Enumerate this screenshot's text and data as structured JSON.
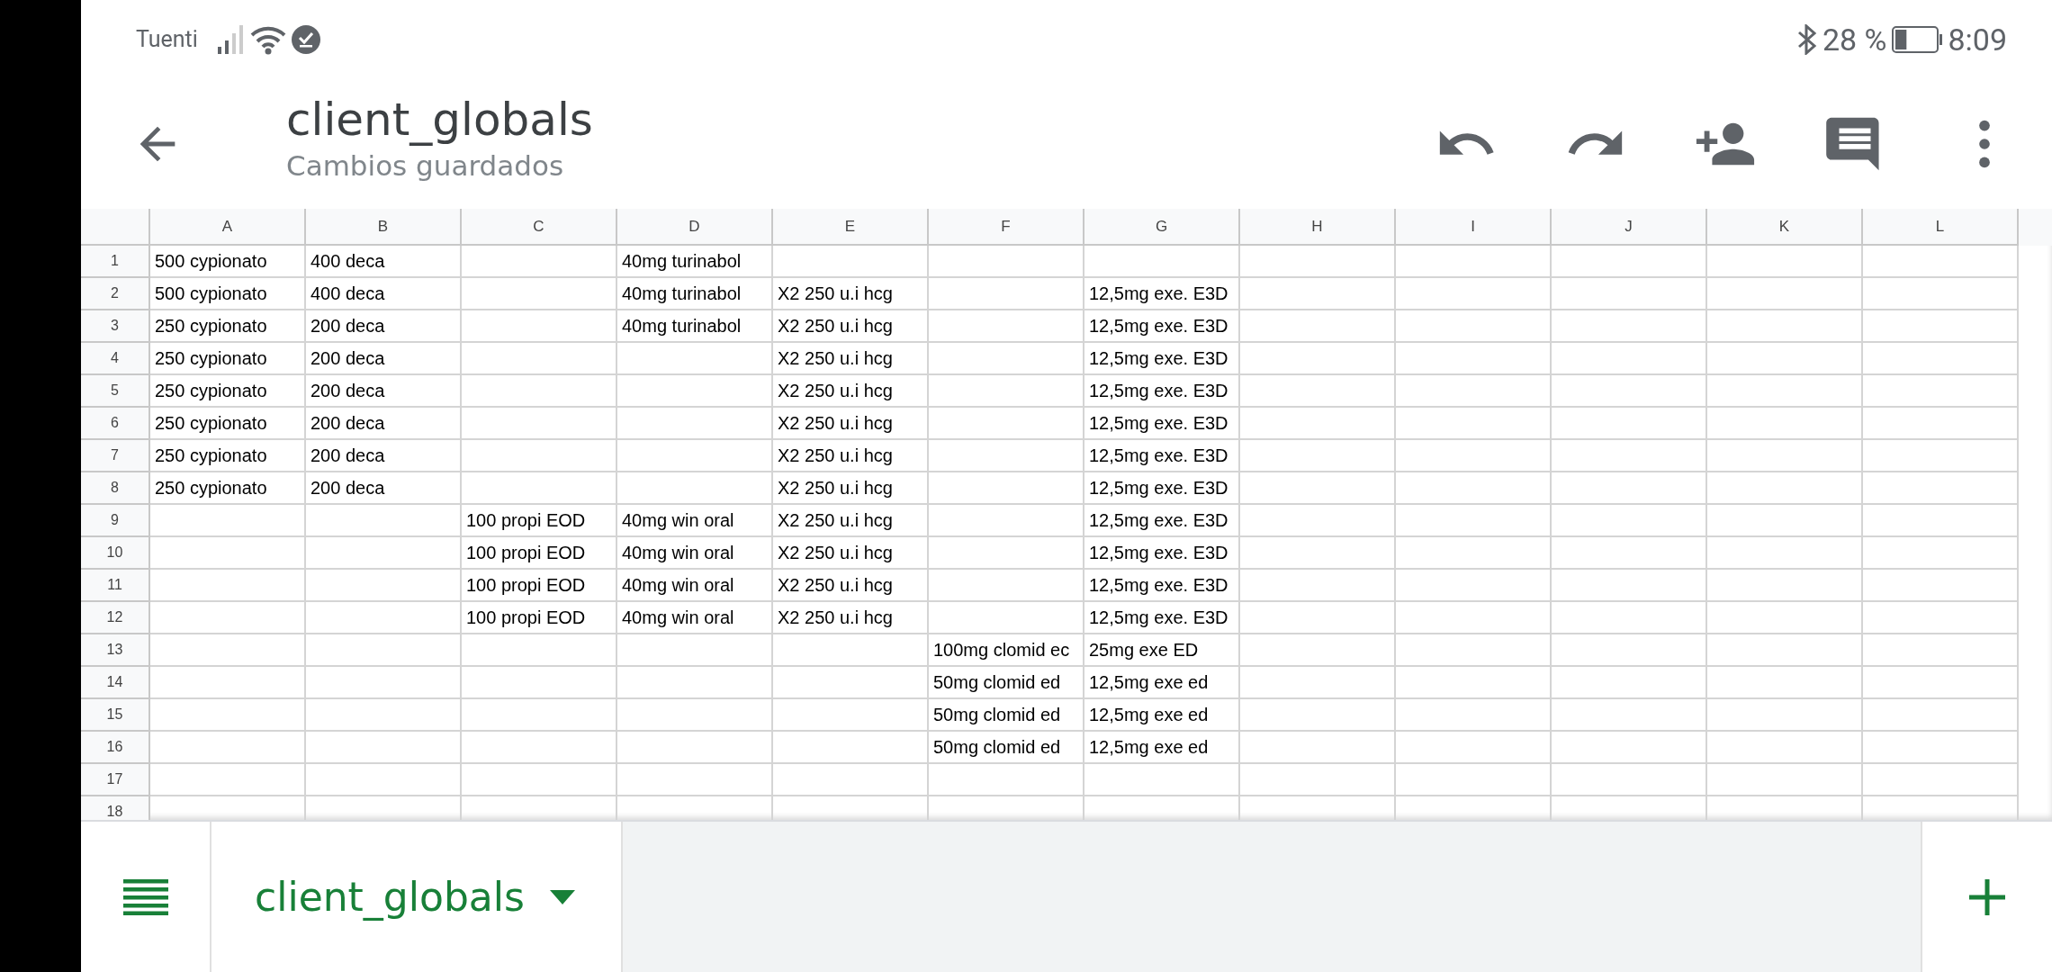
{
  "status_bar": {
    "carrier": "Tuenti",
    "battery_percent": "28 %",
    "time": "8:09"
  },
  "header": {
    "title": "client_globals",
    "subtitle": "Cambios guardados"
  },
  "columns": [
    "A",
    "B",
    "C",
    "D",
    "E",
    "F",
    "G",
    "H",
    "I",
    "J",
    "K",
    "L"
  ],
  "rows": [
    {
      "number": "1",
      "cells": [
        "500 cypionato",
        "400 deca",
        null,
        "40mg turinabol",
        null,
        null,
        null
      ]
    },
    {
      "number": "2",
      "cells": [
        "500 cypionato",
        "400 deca",
        null,
        "40mg turinabol",
        "X2  250 u.i hcg",
        null,
        "12,5mg exe. E3D"
      ]
    },
    {
      "number": "3",
      "cells": [
        "250 cypionato",
        "200 deca",
        null,
        "40mg turinabol",
        "X2  250 u.i hcg",
        null,
        "12,5mg exe. E3D"
      ]
    },
    {
      "number": "4",
      "cells": [
        "250 cypionato",
        "200 deca",
        null,
        null,
        "X2  250 u.i hcg",
        null,
        "12,5mg exe. E3D"
      ]
    },
    {
      "number": "5",
      "cells": [
        "250 cypionato",
        "200 deca",
        null,
        null,
        "X2  250 u.i hcg",
        null,
        "12,5mg exe. E3D"
      ]
    },
    {
      "number": "6",
      "cells": [
        "250 cypionato",
        "200 deca",
        null,
        null,
        "X2  250 u.i hcg",
        null,
        "12,5mg exe. E3D"
      ]
    },
    {
      "number": "7",
      "cells": [
        "250 cypionato",
        "200 deca",
        null,
        null,
        "X2  250 u.i hcg",
        null,
        "12,5mg exe. E3D"
      ]
    },
    {
      "number": "8",
      "cells": [
        "250 cypionato",
        "200 deca",
        null,
        null,
        "X2  250 u.i hcg",
        null,
        "12,5mg exe. E3D"
      ]
    },
    {
      "number": "9",
      "cells": [
        null,
        null,
        "100 propi EOD",
        "40mg win oral",
        "X2  250 u.i hcg",
        null,
        "12,5mg exe. E3D"
      ]
    },
    {
      "number": "10",
      "cells": [
        null,
        null,
        "100 propi EOD",
        "40mg win oral",
        "X2  250 u.i hcg",
        null,
        "12,5mg exe. E3D"
      ]
    },
    {
      "number": "11",
      "cells": [
        null,
        null,
        "100 propi EOD",
        "40mg win oral",
        "X2  250 u.i hcg",
        null,
        "12,5mg exe. E3D"
      ]
    },
    {
      "number": "12",
      "cells": [
        null,
        null,
        "100 propi EOD",
        "40mg win oral",
        "X2  250 u.i hcg",
        null,
        "12,5mg exe. E3D"
      ]
    },
    {
      "number": "13",
      "cells": [
        null,
        null,
        null,
        null,
        null,
        "100mg clomid ec",
        "25mg exe ED"
      ]
    },
    {
      "number": "14",
      "cells": [
        null,
        null,
        null,
        null,
        null,
        "50mg clomid ed",
        "12,5mg exe ed"
      ]
    },
    {
      "number": "15",
      "cells": [
        null,
        null,
        null,
        null,
        null,
        "50mg clomid ed",
        "12,5mg exe ed"
      ]
    },
    {
      "number": "16",
      "cells": [
        null,
        null,
        null,
        null,
        null,
        "50mg clomid ed",
        "12,5mg exe ed"
      ]
    },
    {
      "number": "17"
    },
    {
      "number": "18"
    }
  ],
  "sheet_tabs": [
    {
      "label": "client_globals",
      "selected": true
    }
  ]
}
